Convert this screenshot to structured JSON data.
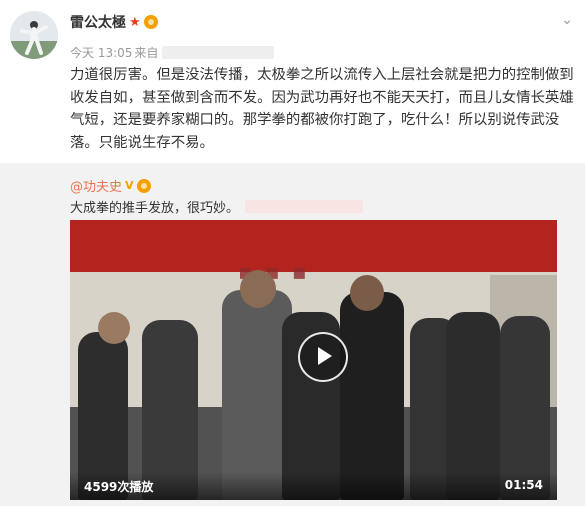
{
  "post": {
    "author": "雷公太極",
    "author_badge_icon": "star-icon",
    "verified_icon": "gold-medal-icon",
    "chevron_icon": "chevron-down-icon",
    "time": "今天 13:05",
    "source_prefix": "来自",
    "body": "力道很厉害。但是没法传播，太极拳之所以流传入上层社会就是把力的控制做到收发自如，甚至做到含而不发。因为武功再好也不能天天打，而且儿女情长英雄气短，还是要养家糊口的。那学拳的都被你打跑了，吃什么！所以别说传武没落。只能说生存不易。"
  },
  "repost": {
    "author": "@功夫史",
    "verified_mark": "V",
    "text": "大成拳的推手发放，很巧妙。"
  },
  "video": {
    "play_count": "4599次播放",
    "duration": "01:54",
    "play_icon": "play-icon",
    "colors": {
      "banner": "#b3241e",
      "wall": "#d8d3c8",
      "floor": "#525252"
    }
  },
  "colors": {
    "accent": "#eb7350",
    "star": "#e6421a",
    "verified": "#f4a000"
  }
}
